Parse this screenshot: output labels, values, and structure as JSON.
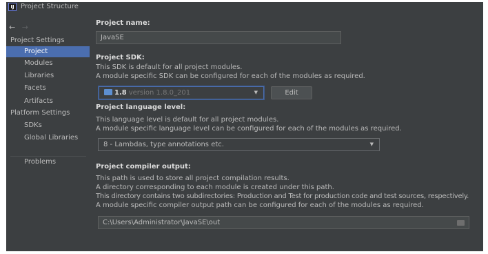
{
  "window": {
    "title": "Project Structure"
  },
  "nav": {
    "back": "←",
    "forward": "→"
  },
  "sidebar": {
    "project_settings_header": "Project Settings",
    "project_settings_items": [
      "Project",
      "Modules",
      "Libraries",
      "Facets",
      "Artifacts"
    ],
    "platform_settings_header": "Platform Settings",
    "platform_settings_items": [
      "SDKs",
      "Global Libraries"
    ],
    "problems": "Problems",
    "selected": "Project"
  },
  "project_name": {
    "label": "Project name:",
    "value": "JavaSE"
  },
  "project_sdk": {
    "label": "Project SDK:",
    "desc1": "This SDK is default for all project modules.",
    "desc2": "A module specific SDK can be configured for each of the modules as required.",
    "sdk_name": "1.8",
    "sdk_version": "version 1.8.0_201",
    "edit_label": "Edit"
  },
  "language_level": {
    "label": "Project language level:",
    "desc1": "This language level is default for all project modules.",
    "desc2": "A module specific language level can be configured for each of the modules as required.",
    "value": "8 - Lambdas, type annotations etc."
  },
  "compiler_output": {
    "label": "Project compiler output:",
    "desc1": "This path is used to store all project compilation results.",
    "desc2": "A directory corresponding to each module is created under this path.",
    "desc3": "This directory contains two subdirectories: Production and Test for production code and test sources, respectively.",
    "desc4": "A module specific compiler output path can be configured for each of the modules as required.",
    "path": "C:\\Users\\Administrator\\JavaSE\\out"
  },
  "colors": {
    "background": "#3c3f41",
    "selection": "#4b6eaf",
    "text": "#bbbbbb",
    "field": "#45494a"
  },
  "icons": [
    "idea-app-icon",
    "back-arrow-icon",
    "forward-arrow-icon",
    "sdk-folder-icon",
    "dropdown-arrow-icon",
    "folder-browse-icon"
  ]
}
